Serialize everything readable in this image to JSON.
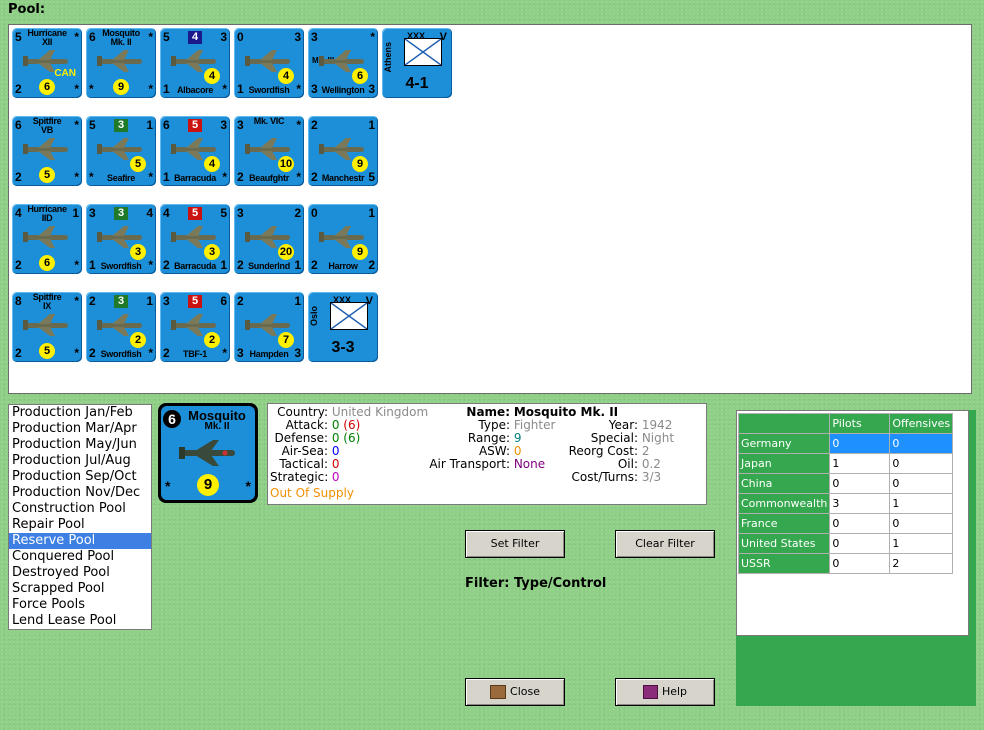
{
  "pool_label": "Pool:",
  "counters": [
    {
      "name": "Hurricane\nXII",
      "tl": "5",
      "tr": "*",
      "bl": "2",
      "mid": "6",
      "br": "*",
      "extra": "CAN"
    },
    {
      "name": "Mosquito\nMk. II",
      "tl": "6",
      "tr": "*",
      "bl": "*",
      "mid": "9",
      "br": "*"
    },
    {
      "flag": "4",
      "tl": "5",
      "tr": "3",
      "bl": "1",
      "bottom": "Albacore",
      "br": "*",
      "rc": "4"
    },
    {
      "tl": "0",
      "tr": "3",
      "bl": "1",
      "bottom": "Swordfish",
      "br": "*",
      "rc": "4"
    },
    {
      "tl": "3",
      "tr": "*",
      "bl": "3",
      "bottom": "Wellington",
      "br": "3",
      "rc": "6",
      "mk": "Mk. III"
    },
    {
      "army_top": "XXX",
      "army_v": "V",
      "army_name": "Athens",
      "army_str": "4-1"
    },
    {
      "name": "Spitfire\nVB",
      "tl": "6",
      "tr": "*",
      "bl": "2",
      "mid": "5",
      "br": "*"
    },
    {
      "flag": "3",
      "tl": "5",
      "tr": "1",
      "bl": "*",
      "bottom": "Seafire",
      "br": "*",
      "rc": "5"
    },
    {
      "flag": "5",
      "tl": "6",
      "tr": "3",
      "bl": "1",
      "bottom": "Barracuda",
      "br": "*",
      "rc": "4"
    },
    {
      "name": "Mk. VIC",
      "tl": "3",
      "tr": "*",
      "bl": "2",
      "bottom": "Beaufghtr",
      "br": "*",
      "rc": "10"
    },
    {
      "tl": "2",
      "tr": "1",
      "bl": "2",
      "bottom": "Manchestr",
      "br": "5",
      "rc": "9"
    },
    {
      "name": "Hurricane\nIID",
      "tl": "4",
      "tr": "1",
      "bl": "2",
      "mid": "6",
      "br": "*"
    },
    {
      "flag": "3",
      "tl": "3",
      "tr": "4",
      "bl": "1",
      "bottom": "Swordfish",
      "br": "*",
      "rc": "3"
    },
    {
      "flag": "5",
      "tl": "4",
      "tr": "5",
      "bl": "2",
      "bottom": "Barracuda",
      "br": "1",
      "rc": "3"
    },
    {
      "tl": "3",
      "tr": "2",
      "bl": "2",
      "bottom": "Sunderlnd",
      "br": "1",
      "rc": "20"
    },
    {
      "tl": "0",
      "tr": "1",
      "bl": "2",
      "bottom": "Harrow",
      "br": "2",
      "rc": "9"
    },
    {
      "name": "Spitfire\nIX",
      "tl": "8",
      "tr": "*",
      "bl": "2",
      "mid": "5",
      "br": "*"
    },
    {
      "flag": "3",
      "tl": "2",
      "tr": "1",
      "bl": "2",
      "bottom": "Swordfish",
      "br": "*",
      "rc": "2"
    },
    {
      "flag": "5",
      "tl": "3",
      "tr": "6",
      "bl": "2",
      "bottom": "TBF-1",
      "br": "*",
      "rc": "2"
    },
    {
      "tl": "2",
      "tr": "1",
      "bl": "3",
      "bottom": "Hampden",
      "br": "3",
      "rc": "7"
    },
    {
      "army_top": "XXX",
      "army_v": "V",
      "army_name": "Oslo",
      "army_str": "3-3"
    }
  ],
  "pool_list": [
    "Production Jan/Feb",
    "Production Mar/Apr",
    "Production May/Jun",
    "Production Jul/Aug",
    "Production Sep/Oct",
    "Production Nov/Dec",
    "Construction Pool",
    "Repair Pool",
    "Reserve Pool",
    "Conquered Pool",
    "Destroyed Pool",
    "Scrapped Pool",
    "Force Pools",
    "Lend Lease Pool"
  ],
  "selected_pool": "Reserve Pool",
  "selected_counter": {
    "tl": "6",
    "name": "Mosquito",
    "sub": "Mk. II",
    "bl": "*",
    "mid": "9",
    "br": "*"
  },
  "detail": {
    "country_label": "Country:",
    "country": "United Kingdom",
    "attack_label": "Attack:",
    "attack_a": "0",
    "attack_b": "(6)",
    "defense_label": "Defense:",
    "defense_a": "0",
    "defense_b": "(6)",
    "airsea_label": "Air-Sea:",
    "airsea": "0",
    "tactical_label": "Tactical:",
    "tactical": "0",
    "strategic_label": "Strategic:",
    "strategic": "0",
    "supply": "Out Of Supply",
    "name_label": "Name:",
    "name": "Mosquito Mk. II",
    "type_label": "Type:",
    "type": "Fighter",
    "range_label": "Range:",
    "range": "9",
    "asw_label": "ASW:",
    "asw": "0",
    "airtransport_label": "Air Transport:",
    "airtransport": "None",
    "year_label": "Year:",
    "year": "1942",
    "special_label": "Special:",
    "special": "Night",
    "reorg_label": "Reorg Cost:",
    "reorg": "2",
    "oil_label": "Oil:",
    "oil": "0.2",
    "cost_label": "Cost/Turns:",
    "cost": "3/3"
  },
  "buttons": {
    "set_filter": "Set Filter",
    "clear_filter": "Clear Filter",
    "close": "Close",
    "help": "Help"
  },
  "filter_text": "Filter: Type/Control",
  "stats_table": {
    "headers": [
      "",
      "Pilots",
      "Offensives"
    ],
    "rows": [
      [
        "Germany",
        "0",
        "0"
      ],
      [
        "Japan",
        "1",
        "0"
      ],
      [
        "China",
        "0",
        "0"
      ],
      [
        "Commonwealth",
        "3",
        "1"
      ],
      [
        "France",
        "0",
        "0"
      ],
      [
        "United States",
        "0",
        "1"
      ],
      [
        "USSR",
        "0",
        "2"
      ]
    ]
  }
}
